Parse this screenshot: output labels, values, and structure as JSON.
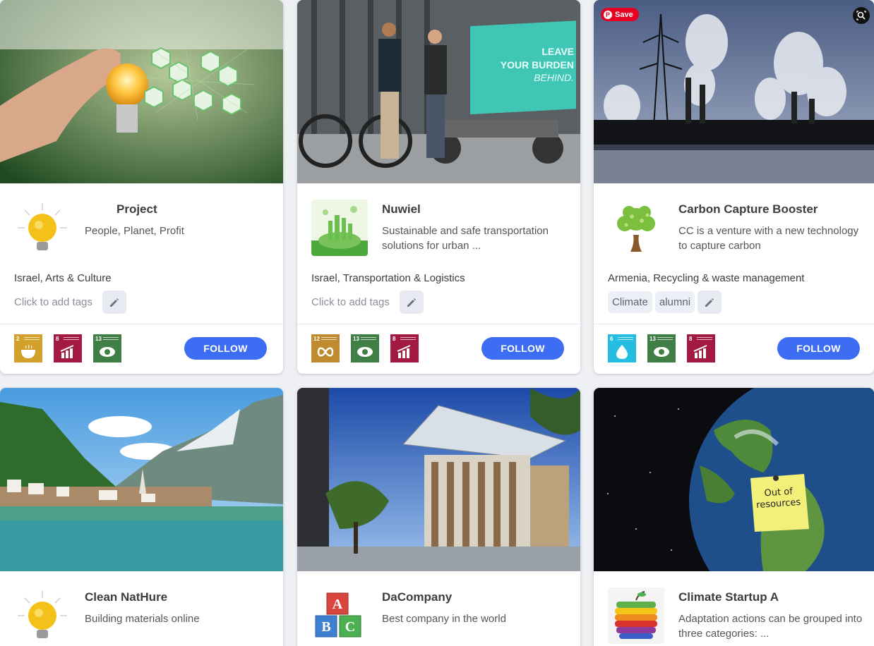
{
  "cards": [
    {
      "name": "Project",
      "description": "People, Planet, Profit",
      "location": "Israel, Arts & Culture",
      "add_tags": "Click to add tags",
      "tags": [],
      "sdgs": [
        {
          "num": "2",
          "label": "ZERO HUNGER",
          "color": "#d3a029"
        },
        {
          "num": "8",
          "label": "DECENT WORK AND ECONOMIC GROWTH",
          "color": "#a21942"
        },
        {
          "num": "13",
          "label": "CLIMATE ACTION",
          "color": "#3f7e44"
        }
      ],
      "follow": "FOLLOW"
    },
    {
      "name": "Nuwiel",
      "description": "Sustainable and safe transportation solutions for urban ...",
      "location": "Israel, Transportation & Logistics",
      "add_tags": "Click to add tags",
      "tags": [],
      "image_text": [
        "LEAVE",
        "YOUR BURDEN",
        "BEHIND."
      ],
      "sdgs": [
        {
          "num": "12",
          "label": "RESPONSIBLE CONSUMPTION AND PRODUCTION",
          "color": "#bf8b2e"
        },
        {
          "num": "13",
          "label": "CLIMATE ACTION",
          "color": "#3f7e44"
        },
        {
          "num": "8",
          "label": "DECENT WORK AND ECONOMIC GROWTH",
          "color": "#a21942"
        }
      ],
      "follow": "FOLLOW"
    },
    {
      "name": "Carbon Capture Booster",
      "description": "CC is a venture with a new technology to capture carbon",
      "location": "Armenia, Recycling & waste management",
      "tags": [
        "Climate",
        "alumni"
      ],
      "save_label": "Save",
      "sdgs": [
        {
          "num": "6",
          "label": "CLEAN WATER AND SANITATION",
          "color": "#26bde2"
        },
        {
          "num": "13",
          "label": "CLIMATE ACTION",
          "color": "#3f7e44"
        },
        {
          "num": "8",
          "label": "DECENT WORK AND ECONOMIC GROWTH",
          "color": "#a21942"
        }
      ],
      "follow": "FOLLOW"
    },
    {
      "name": "Clean NatHure",
      "description": "Building materials online"
    },
    {
      "name": "DaCompany",
      "description": "Best company in the world"
    },
    {
      "name": "Climate Startup A",
      "description": "Adaptation actions can be grouped into three categories: ...",
      "image_note": [
        "Out of",
        "resources"
      ]
    }
  ],
  "icons": {
    "edit": "pencil-icon",
    "save": "pinterest-icon",
    "lens": "visual-search-icon"
  },
  "colors": {
    "accent": "#3d6df2",
    "tag_bg": "#eceff5"
  }
}
